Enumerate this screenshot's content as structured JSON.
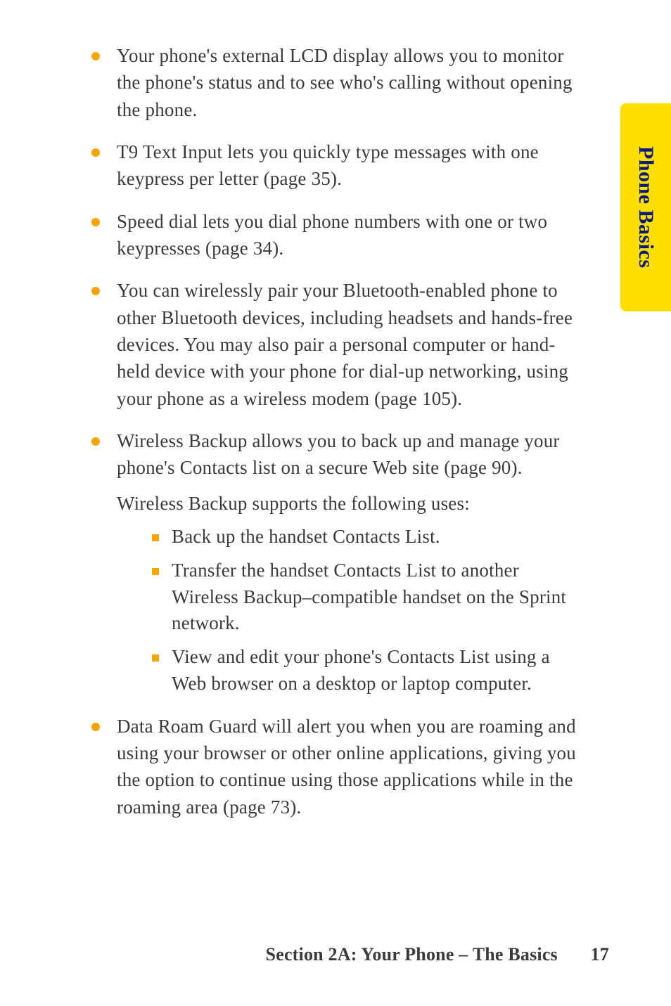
{
  "sideTab": "Phone Basics",
  "bullets": {
    "item0": "Your phone's external LCD display allows you to monitor the phone's status and to see who's calling without opening the phone.",
    "item1": "T9 Text Input lets you quickly type messages with one keypress per letter (page 35).",
    "item2": "Speed dial lets you dial phone numbers with one or two keypresses (page 34).",
    "item3": "You can  wirelessly pair your Bluetooth-enabled phone to other Bluetooth devices, including headsets and hands-free devices.  You may also pair a personal computer or hand-held device with your phone for dial-up networking, using your phone as a wireless  modem (page 105).",
    "item4": "Wireless Backup allows you to back up and manage your phone's Contacts list on a secure Web site (page 90).",
    "subheading": "Wireless Backup supports the following uses:",
    "sub0": "Back up the handset Contacts List.",
    "sub1": "Transfer the handset Contacts List to another Wireless Backup–compatible handset on the Sprint network.",
    "sub2": "View and edit your phone's Contacts List using a Web browser on a desktop or laptop computer.",
    "item5": "Data Roam Guard will alert you when you are roaming and using your browser or other online applications, giving you the option to continue using those applications while in the roaming area (page 73)."
  },
  "footer": {
    "section": "Section 2A: Your Phone – The Basics",
    "page": "17"
  }
}
